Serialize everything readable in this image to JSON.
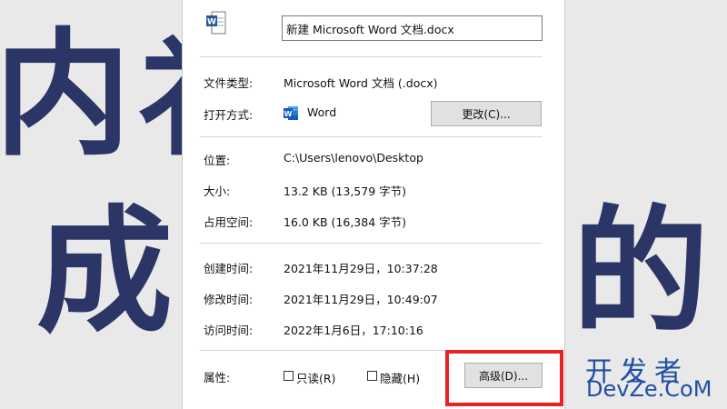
{
  "background": {
    "chars": [
      "内",
      "礻",
      "成",
      "的"
    ]
  },
  "file_icon": "word-document-icon",
  "file_name": "新建 Microsoft Word 文档.docx",
  "fields": {
    "type_label": "文件类型:",
    "type_value": "Microsoft Word 文档 (.docx)",
    "open_with_label": "打开方式:",
    "open_with_value": "Word",
    "change_button": "更改(C)...",
    "location_label": "位置:",
    "location_value": "C:\\Users\\lenovo\\Desktop",
    "size_label": "大小:",
    "size_value": "13.2 KB (13,579 字节)",
    "disk_size_label": "占用空间:",
    "disk_size_value": "16.0 KB (16,384 字节)",
    "created_label": "创建时间:",
    "created_value": "2021年11月29日，10:37:28",
    "modified_label": "修改时间:",
    "modified_value": "2021年11月29日，10:49:07",
    "accessed_label": "访问时间:",
    "accessed_value": "2022年1月6日，17:10:16",
    "attributes_label": "属性:",
    "readonly_label": "只读(R)",
    "hidden_label": "隐藏(H)",
    "advanced_button": "高级(D)..."
  },
  "watermark": {
    "line1": "开发者",
    "line2": "DevZe.CoM"
  },
  "colors": {
    "word_blue": "#2b5797",
    "highlight_red": "#e52323",
    "watermark_blue": "#1f4ea3"
  }
}
